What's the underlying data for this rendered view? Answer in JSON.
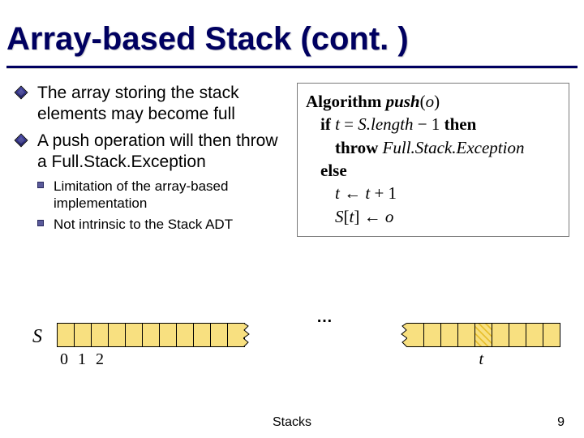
{
  "title": "Array-based Stack (cont. )",
  "bullets": [
    "The array storing the stack elements may become full",
    "A push operation will then throw a Full.Stack.Exception"
  ],
  "sub_bullets": [
    "Limitation of the array-based implementation",
    "Not intrinsic to the Stack ADT"
  ],
  "algo": {
    "kw_algorithm": "Algorithm",
    "fn_name": "push",
    "fn_arg": "o",
    "kw_if": "if",
    "cond_lhs": "t",
    "cond_eq": " = ",
    "cond_rhs": "S.length",
    "cond_minus": " − 1 ",
    "kw_then": "then",
    "kw_throw": "throw",
    "exc": "Full.Stack.Exception",
    "kw_else": "else",
    "assign1_lhs": "t",
    "assign1_arrow": " ← ",
    "assign1_rhs_a": "t",
    "assign1_rhs_b": " + 1",
    "assign2_lhs": "S",
    "assign2_idx": "t",
    "assign2_arrow": " ← ",
    "assign2_rhs": "o"
  },
  "diagram": {
    "label": "S",
    "dots": "…",
    "indices": {
      "i0": "0",
      "i1": "1",
      "i2": "2",
      "t": "t"
    },
    "left_cells": 11,
    "right_cells": 9,
    "current_right_index": 4
  },
  "footer": "Stacks",
  "page": "9"
}
